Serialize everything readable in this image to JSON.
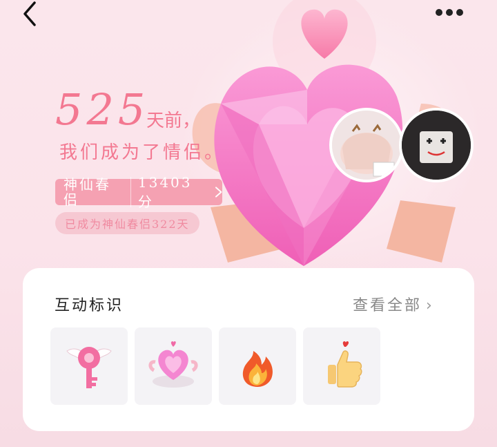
{
  "header": {
    "back_icon": "chevron-left-icon",
    "more_icon": "more-dots-icon"
  },
  "relationship": {
    "days": "525",
    "days_suffix": "天前，",
    "became_couple": "我们成为了情侣。",
    "level_name": "神仙春侣",
    "score": "13403 分",
    "since_text": "已成为神仙春侣322天"
  },
  "interaction_card": {
    "title": "互动标识",
    "view_all": "查看全部",
    "badges": [
      {
        "icon": "winged-key-icon"
      },
      {
        "icon": "heart-gem-icon"
      },
      {
        "icon": "fire-icon"
      },
      {
        "icon": "thumbs-up-heart-icon"
      }
    ]
  },
  "colors": {
    "accent": "#f37891",
    "pill": "#f5a1b2",
    "card_bg": "#ffffff",
    "page_bg": "#fbe6ec"
  }
}
